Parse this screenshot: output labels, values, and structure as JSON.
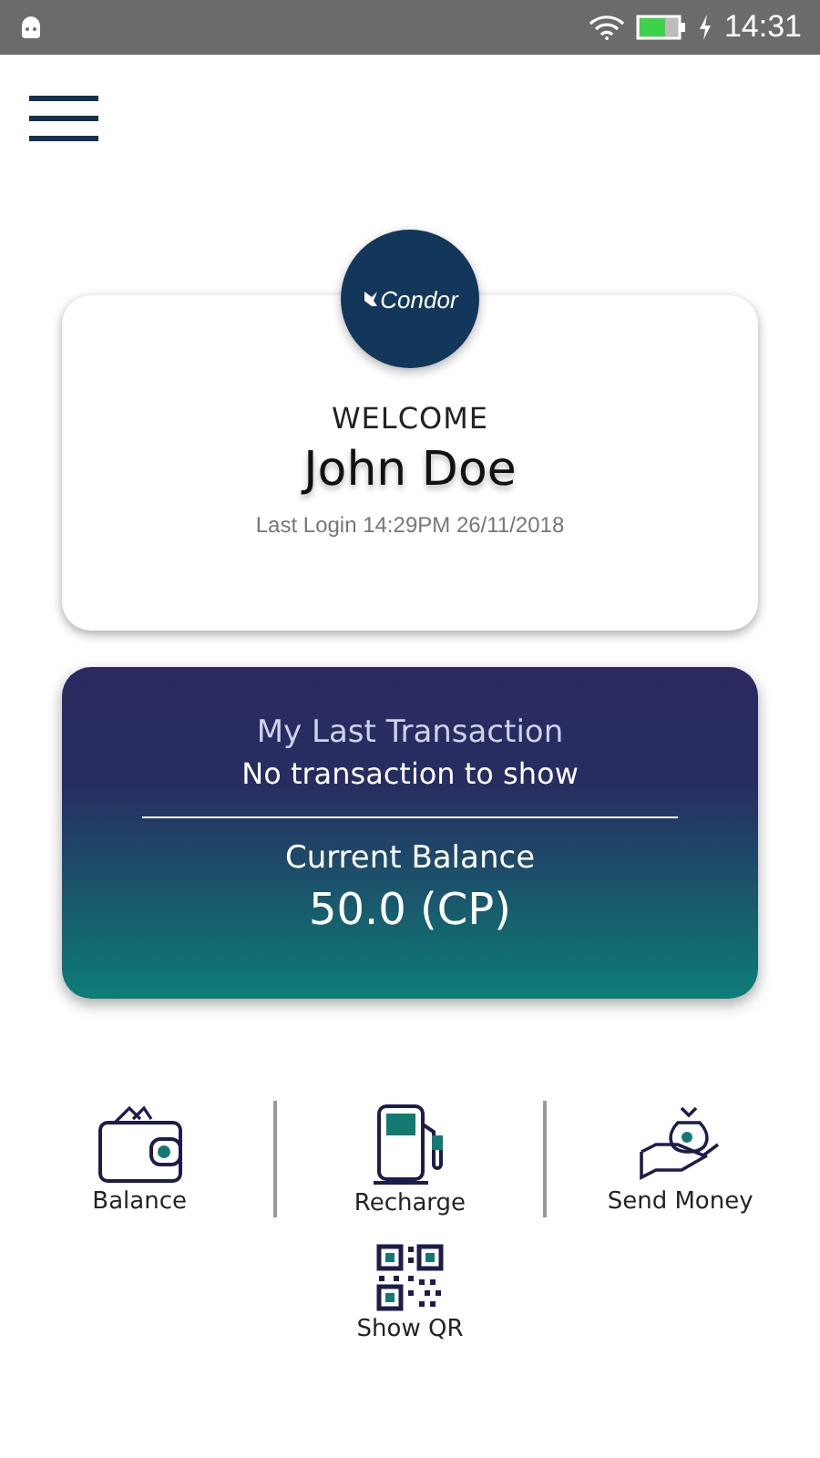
{
  "status_bar": {
    "time": "14:31"
  },
  "logo": {
    "text": "Condor"
  },
  "welcome": {
    "greeting": "WELCOME",
    "name": "John Doe",
    "last_login": "Last Login 14:29PM 26/11/2018"
  },
  "transaction": {
    "title": "My Last Transaction",
    "message": "No transaction to show",
    "balance_label": "Current Balance",
    "balance": "50.0 (CP)"
  },
  "actions": [
    {
      "kind": "wallet",
      "label": "Balance"
    },
    {
      "kind": "pump",
      "label": "Recharge"
    },
    {
      "kind": "money",
      "label": "Send Money"
    },
    {
      "kind": "qr",
      "label": "Show QR"
    }
  ]
}
